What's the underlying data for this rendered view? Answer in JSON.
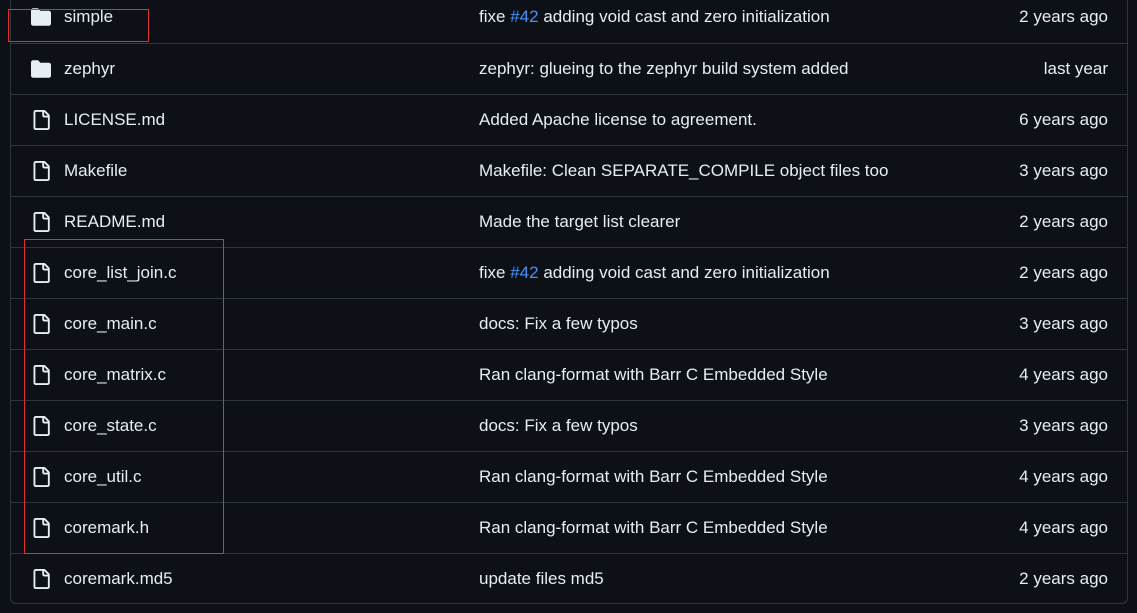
{
  "files": [
    {
      "name": "simple",
      "type": "dir",
      "icon": "folder-icon",
      "msg_prefix": "fixe",
      "issue": "#42",
      "msg_suffix": "adding void cast and zero initialization",
      "date": "2 years ago"
    },
    {
      "name": "zephyr",
      "type": "dir",
      "icon": "folder-icon",
      "msg_prefix": "zephyr: glueing to the zephyr build system added",
      "issue": "",
      "msg_suffix": "",
      "date": "last year"
    },
    {
      "name": "LICENSE.md",
      "type": "file",
      "icon": "file-icon",
      "msg_prefix": "Added Apache license to agreement.",
      "issue": "",
      "msg_suffix": "",
      "date": "6 years ago"
    },
    {
      "name": "Makefile",
      "type": "file",
      "icon": "file-icon",
      "msg_prefix": "Makefile: Clean SEPARATE_COMPILE object files too",
      "issue": "",
      "msg_suffix": "",
      "date": "3 years ago"
    },
    {
      "name": "README.md",
      "type": "file",
      "icon": "file-icon",
      "msg_prefix": "Made the target list clearer",
      "issue": "",
      "msg_suffix": "",
      "date": "2 years ago"
    },
    {
      "name": "core_list_join.c",
      "type": "file",
      "icon": "file-icon",
      "msg_prefix": "fixe",
      "issue": "#42",
      "msg_suffix": "adding void cast and zero initialization",
      "date": "2 years ago"
    },
    {
      "name": "core_main.c",
      "type": "file",
      "icon": "file-icon",
      "msg_prefix": "docs: Fix a few typos",
      "issue": "",
      "msg_suffix": "",
      "date": "3 years ago"
    },
    {
      "name": "core_matrix.c",
      "type": "file",
      "icon": "file-icon",
      "msg_prefix": "Ran clang-format with Barr C Embedded Style",
      "issue": "",
      "msg_suffix": "",
      "date": "4 years ago"
    },
    {
      "name": "core_state.c",
      "type": "file",
      "icon": "file-icon",
      "msg_prefix": "docs: Fix a few typos",
      "issue": "",
      "msg_suffix": "",
      "date": "3 years ago"
    },
    {
      "name": "core_util.c",
      "type": "file",
      "icon": "file-icon",
      "msg_prefix": "Ran clang-format with Barr C Embedded Style",
      "issue": "",
      "msg_suffix": "",
      "date": "4 years ago"
    },
    {
      "name": "coremark.h",
      "type": "file",
      "icon": "file-icon",
      "msg_prefix": "Ran clang-format with Barr C Embedded Style",
      "issue": "",
      "msg_suffix": "",
      "date": "4 years ago"
    },
    {
      "name": "coremark.md5",
      "type": "file",
      "icon": "file-icon",
      "msg_prefix": "update files md5",
      "issue": "",
      "msg_suffix": "",
      "date": "2 years ago"
    }
  ],
  "colors": {
    "background": "#0d1117",
    "border": "#30363d",
    "text": "#e6edf3",
    "link": "#4493f8",
    "icon": "#e6edf3",
    "highlight": "#e03131"
  }
}
